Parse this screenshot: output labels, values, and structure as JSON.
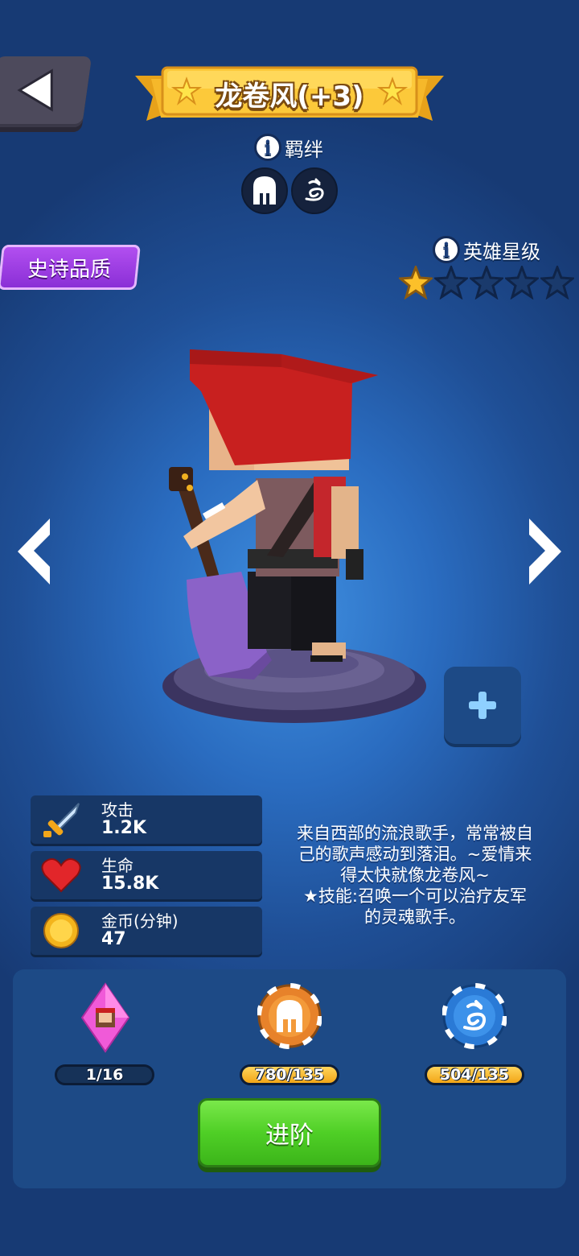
{
  "header": {
    "back_icon": "back-arrow-icon",
    "title": "龙卷风(+3)"
  },
  "bond": {
    "label": "羁绊",
    "icons": [
      "spartan-helmet-icon",
      "dragon-emblem-icon"
    ]
  },
  "rarity": {
    "label": "史诗品质",
    "color": "#a33ee8"
  },
  "hero_star": {
    "label": "英雄星级",
    "filled": 1,
    "total": 5
  },
  "stats": [
    {
      "icon": "sword-icon",
      "label": "攻击",
      "value": "1.2K"
    },
    {
      "icon": "heart-icon",
      "label": "生命",
      "value": "15.8K"
    },
    {
      "icon": "coin-icon",
      "label": "金币(分钟)",
      "value": "47"
    }
  ],
  "description": [
    "来自西部的流浪歌手，常常被自",
    "己的歌声感动到落泪。~爱情来",
    "得太快就像龙卷风~",
    "★技能:召唤一个可以治疗友军",
    "的灵魂歌手。"
  ],
  "resources": [
    {
      "icon": "hero-shard-gem-icon",
      "value": "1/16"
    },
    {
      "icon": "helmet-token-icon",
      "value": "780/135"
    },
    {
      "icon": "dragon-token-icon",
      "value": "504/135"
    }
  ],
  "advance_button": {
    "label": "进阶",
    "color": "#4fcf26"
  }
}
